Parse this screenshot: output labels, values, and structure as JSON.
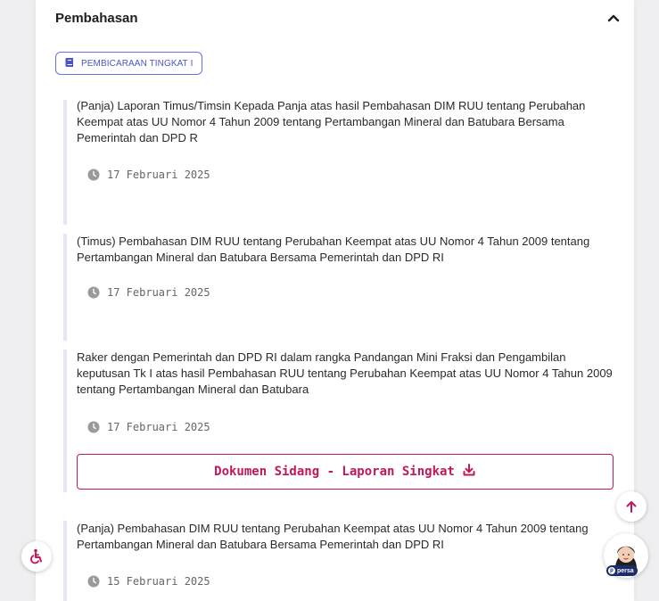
{
  "section": {
    "title": "Pembahasan"
  },
  "badge": {
    "label": "PEMBICARAAN TINGKAT I"
  },
  "items": [
    {
      "text": "(Panja) Laporan Timus/Timsin Kepada Panja atas hasil Pembahasan DIM RUU tentang Perubahan Keempat atas UU Nomor 4 Tahun 2009 tentang Pertambangan Mineral dan Batubara Bersama Pemerintah dan DPD R",
      "date": "17 Februari 2025"
    },
    {
      "text": "(Timus) Pembahasan DIM RUU tentang Perubahan Keempat atas UU Nomor 4 Tahun 2009 tentang Pertambangan Mineral dan Batubara Bersama Pemerintah dan DPD RI",
      "date": "17 Februari 2025"
    },
    {
      "text": "Raker dengan Pemerintah dan DPD RI dalam rangka Pandangan Mini Fraksi dan Pengambilan keputusan Tk I atas hasil Pembahasan RUU tentang Perubahan Keempat atas UU Nomor 4 Tahun 2009 tentang Pertambangan Mineral dan Batubara",
      "date": "17 Februari 2025",
      "button_label": "Dokumen Sidang - Laporan Singkat"
    },
    {
      "text": "(Panja) Pembahasan DIM RUU tentang Perubahan Keempat atas UU Nomor 4 Tahun 2009 tentang Pertambangan Mineral dan Batubara Bersama Pemerintah dan DPD RI",
      "date": "15 Februari 2025"
    }
  ],
  "assistant": {
    "tag": "persa"
  },
  "colors": {
    "accent": "#c2185b",
    "badge": "#4b55c4",
    "timeline": "#e4e6f5"
  },
  "icons": {
    "collapse": "chevron-up-icon",
    "badge": "book-icon",
    "date": "clock-icon",
    "download": "download-icon",
    "scroll_top": "arrow-up-icon",
    "accessibility": "wheelchair-icon"
  }
}
